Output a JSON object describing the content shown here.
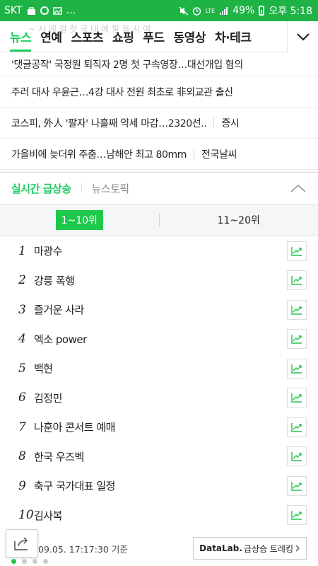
{
  "status_bar": {
    "carrier": "SKT",
    "network": "LTE",
    "battery": "49%",
    "time": "오후 5:18"
  },
  "nav": {
    "ghost_text": "~ 시 에 걸  첫 국 대 에 필  돌  시  예",
    "tabs": [
      {
        "label": "뉴스",
        "active": true
      },
      {
        "label": "연예"
      },
      {
        "label": "스포츠"
      },
      {
        "label": "쇼핑"
      },
      {
        "label": "푸드"
      },
      {
        "label": "동영상"
      },
      {
        "label": "차·테크"
      }
    ]
  },
  "headlines": [
    {
      "title": "'댓글공작' 국정원 퇴직자 2명 첫 구속영장…대선개입 혐의",
      "tag": ""
    },
    {
      "title": "주러 대사 우윤근…4강 대사 전원 최초로 非외교관 출신",
      "tag": ""
    },
    {
      "title": "코스피, 外人 '팔자' 나흘째 약세 마감…2320선..",
      "tag": "증시"
    },
    {
      "title": "가을비에 늦더위 주춤…남해안 최고 80mm",
      "tag": "전국날씨"
    }
  ],
  "rank_tabs": {
    "realtime": "실시간 급상승",
    "topic": "뉴스토픽"
  },
  "range": {
    "first": "1~10위",
    "second": "11~20위"
  },
  "keywords": [
    {
      "rank": "1",
      "keyword": "마광수"
    },
    {
      "rank": "2",
      "keyword": "강릉 폭행"
    },
    {
      "rank": "3",
      "keyword": "즐거운 사라"
    },
    {
      "rank": "4",
      "keyword": "엑소 power"
    },
    {
      "rank": "5",
      "keyword": "백현"
    },
    {
      "rank": "6",
      "keyword": "김정민"
    },
    {
      "rank": "7",
      "keyword": "나훈아 콘서트 예매"
    },
    {
      "rank": "8",
      "keyword": "한국 우즈벡"
    },
    {
      "rank": "9",
      "keyword": "축구 국가대표 일정"
    },
    {
      "rank": "10",
      "keyword": "김사복"
    }
  ],
  "footer": {
    "timestamp": "09.05. 17:17:30 기준",
    "datalab_brand": "DataLab.",
    "datalab_label": "급상승 트레킹"
  },
  "colors": {
    "status_green": "#1fb346",
    "accent_green": "#19ce60",
    "range_active_green": "#1ec84a"
  }
}
